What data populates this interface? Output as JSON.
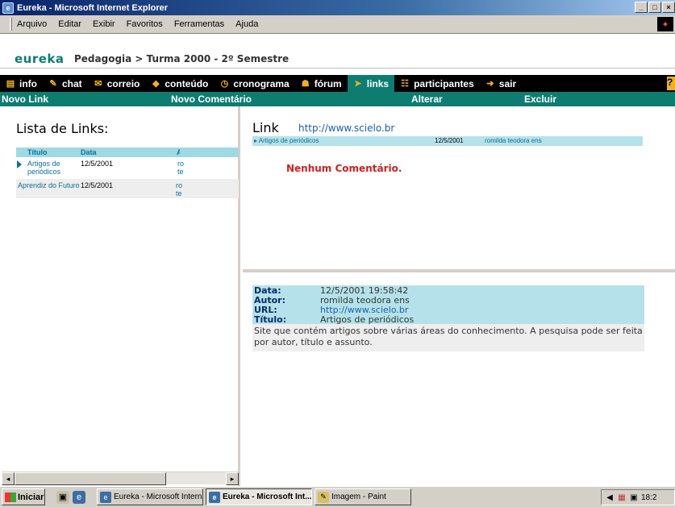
{
  "window": {
    "title": "Eureka - Microsoft Internet Explorer",
    "buttons": [
      "_",
      "□",
      "×"
    ]
  },
  "menubar": {
    "items": [
      "Arquivo",
      "Editar",
      "Exibir",
      "Favoritos",
      "Ferramentas",
      "Ajuda"
    ]
  },
  "site": {
    "logo": "eureka",
    "breadcrumb": "Pedagogia > Turma 2000 - 2º Semestre"
  },
  "nav": {
    "items": [
      {
        "label": "info",
        "icon": "info-icon"
      },
      {
        "label": "chat",
        "icon": "chat-icon"
      },
      {
        "label": "correio",
        "icon": "mail-icon"
      },
      {
        "label": "conteúdo",
        "icon": "content-icon"
      },
      {
        "label": "cronograma",
        "icon": "schedule-icon"
      },
      {
        "label": "fórum",
        "icon": "forum-icon"
      },
      {
        "label": "links",
        "icon": "links-icon"
      },
      {
        "label": "participantes",
        "icon": "participants-icon"
      },
      {
        "label": "sair",
        "icon": "exit-icon"
      }
    ],
    "active": "links",
    "help": "?"
  },
  "actions": {
    "new_link": "Novo Link",
    "new_comment": "Novo Comentário",
    "edit": "Alterar",
    "delete": "Excluir"
  },
  "left": {
    "title": "Lista de Links:",
    "columns": [
      "Título",
      "Data",
      "Au"
    ],
    "rows": [
      {
        "title": "Artigos de periódicos",
        "date": "12/5/2001",
        "author": "ro te",
        "selected": true
      },
      {
        "title": "Aprendiz do Futuro",
        "date": "12/5/2001",
        "author": "ro te",
        "selected": false
      }
    ]
  },
  "link_panel": {
    "heading": "Link",
    "url": "http://www.scielo.br",
    "bar_title": "Artigos de periódicos",
    "bar_date": "12/5/2001",
    "bar_author": "romilda teodora ens",
    "no_comment": "Nenhum Comentário."
  },
  "detail": {
    "date_label": "Data:",
    "date_value": "12/5/2001 19:58:42",
    "author_label": "Autor:",
    "author_value": "romilda teodora ens",
    "url_label": "URL:",
    "url_value": "http://www.scielo.br",
    "title_label": "Título:",
    "title_value": "Artigos de periódicos",
    "description": "Site que contém artigos sobre várias áreas do conhecimento. A pesquisa pode ser feita por autor, título e assunto."
  },
  "taskbar": {
    "start": "Iniciar",
    "tasks": [
      {
        "label": "Eureka - Microsoft Internet...",
        "active": false
      },
      {
        "label": "Eureka - Microsoft Int...",
        "active": true
      },
      {
        "label": "Imagem - Paint",
        "active": false
      }
    ],
    "clock": "18:2"
  },
  "colors": {
    "teal": "#0d7d72",
    "light_cyan": "#b5e2ea",
    "link_blue": "#1b5fb0",
    "alert_red": "#d02020"
  }
}
